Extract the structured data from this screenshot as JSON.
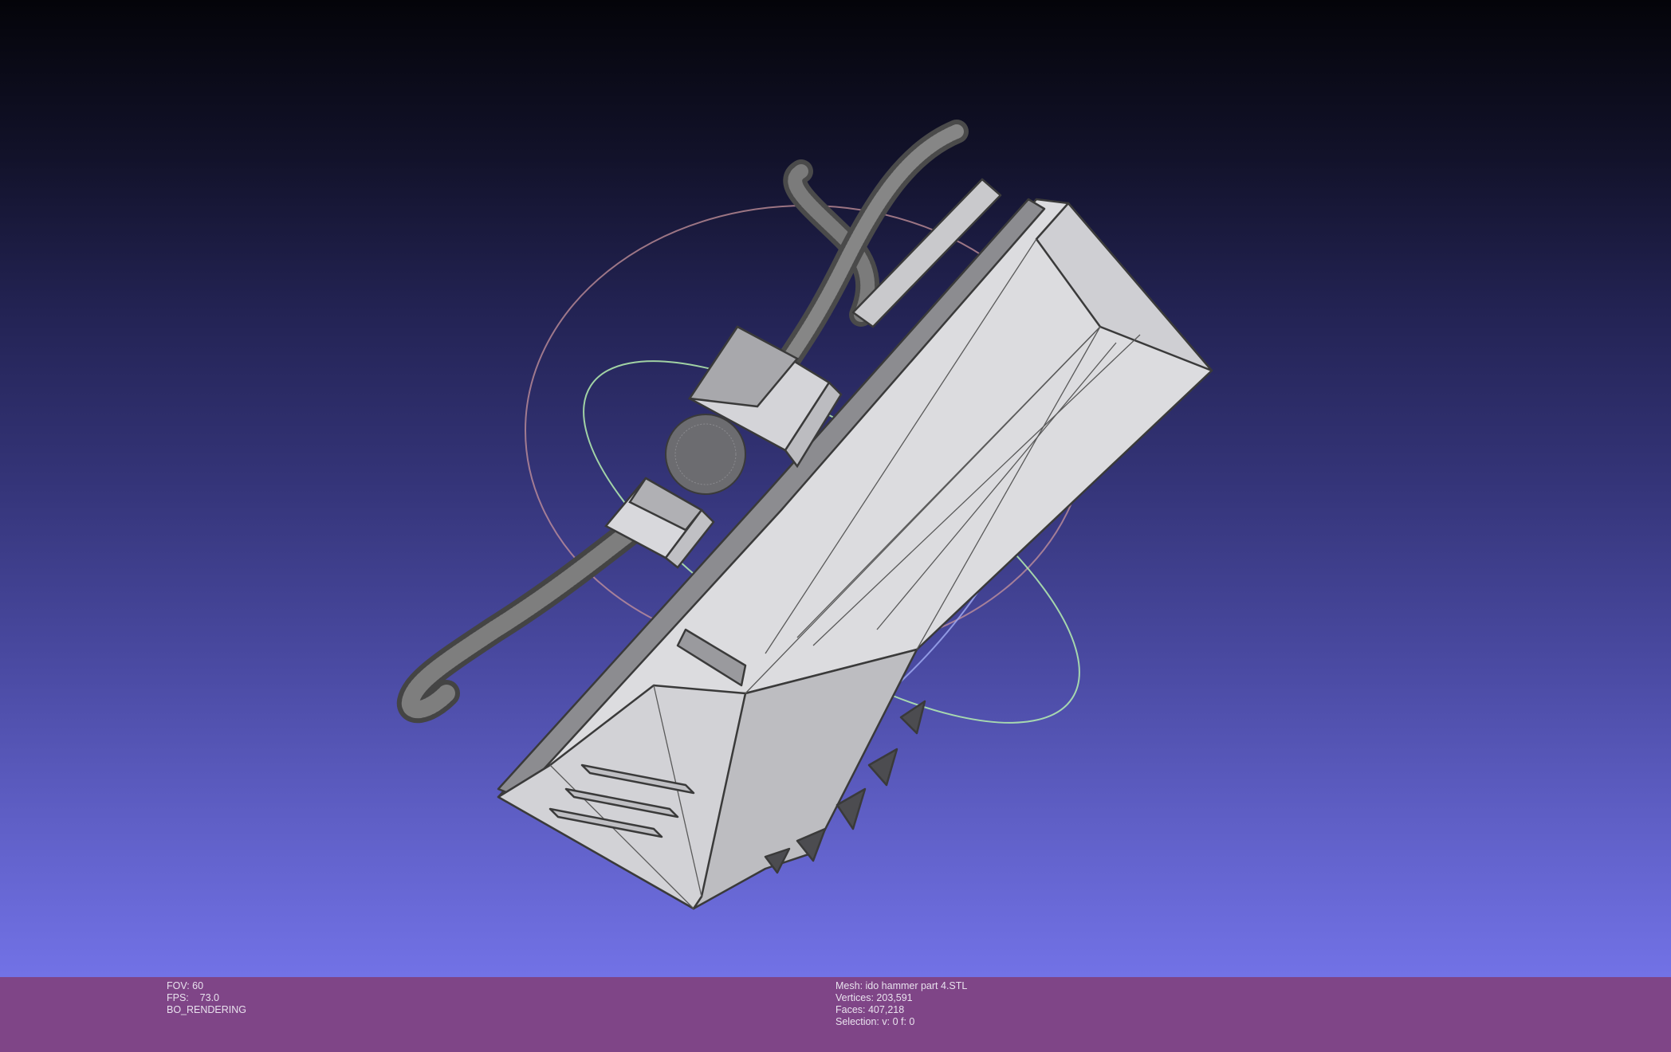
{
  "render_info": {
    "fov": "FOV: 60",
    "fps": "FPS:    73.0",
    "mode": "BO_RENDERING"
  },
  "mesh_info": {
    "mesh": "Mesh: ido hammer part 4.STL",
    "vertices": "Vertices: 203,591",
    "faces": "Faces: 407,218",
    "selection": "Selection: v: 0 f: 0"
  },
  "colors": {
    "bar_bg": "#7f4587",
    "bg_top": "#040409",
    "bg_bottom": "#7272e6",
    "mesh_fill": "#dcdcdf",
    "mesh_edge": "#3a3a3a",
    "trackball_green": "#b6f0b0",
    "trackball_blue": "#9ea8f0",
    "trackball_red": "#c8949c"
  }
}
